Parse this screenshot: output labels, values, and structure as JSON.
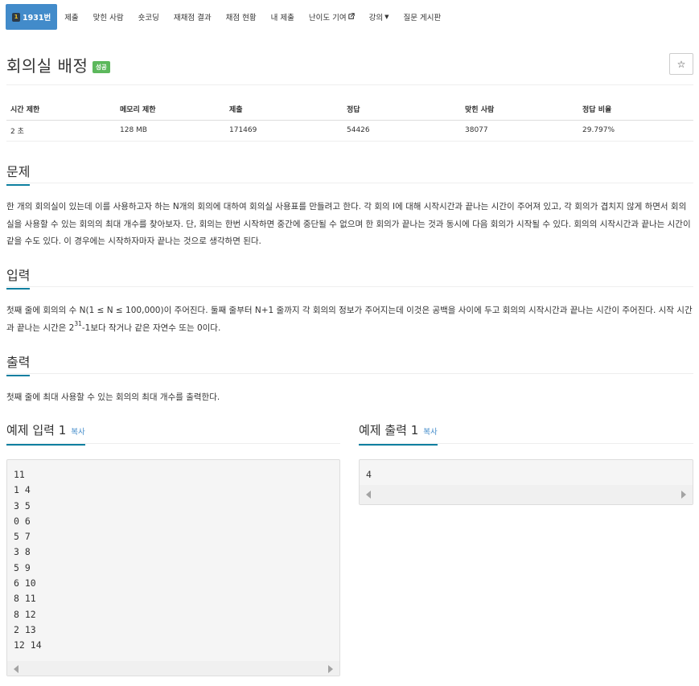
{
  "nav": {
    "problem_id": "1931번",
    "tabs": [
      "제출",
      "맞힌 사람",
      "숏코딩",
      "재채점 결과",
      "채점 현황",
      "내 제출",
      "난이도 기여",
      "강의",
      "질문 게시판"
    ],
    "tier_icon_glyph": "1"
  },
  "problem": {
    "title": "회의실 배정",
    "status_badge": "성공",
    "star_glyph": "☆"
  },
  "info_table": {
    "headers": [
      "시간 제한",
      "메모리 제한",
      "제출",
      "정답",
      "맞힌 사람",
      "정답 비율"
    ],
    "values": [
      "2 초",
      "128 MB",
      "171469",
      "54426",
      "38077",
      "29.797%"
    ]
  },
  "sections": {
    "description_title": "문제",
    "description_text": "한 개의 회의실이 있는데 이를 사용하고자 하는 N개의 회의에 대하여 회의실 사용표를 만들려고 한다. 각 회의 I에 대해 시작시간과 끝나는 시간이 주어져 있고, 각 회의가 겹치지 않게 하면서 회의실을 사용할 수 있는 회의의 최대 개수를 찾아보자. 단, 회의는 한번 시작하면 중간에 중단될 수 없으며 한 회의가 끝나는 것과 동시에 다음 회의가 시작될 수 있다. 회의의 시작시간과 끝나는 시간이 같을 수도 있다. 이 경우에는 시작하자마자 끝나는 것으로 생각하면 된다.",
    "input_title": "입력",
    "input_text_a": "첫째 줄에 회의의 수 N(1 ≤ N ≤ 100,000)이 주어진다. 둘째 줄부터 N+1 줄까지 각 회의의 정보가 주어지는데 이것은 공백을 사이에 두고 회의의 시작시간과 끝나는 시간이 주어진다. 시작 시간과 끝나는 시간은 2",
    "input_text_sup": "31",
    "input_text_b": "-1보다 작거나 같은 자연수 또는 0이다.",
    "output_title": "출력",
    "output_text": "첫째 줄에 최대 사용할 수 있는 회의의 최대 개수를 출력한다."
  },
  "samples": {
    "input_title": "예제 입력 1",
    "output_title": "예제 출력 1",
    "copy_label": "복사",
    "input_lines": [
      "11",
      "1 4",
      "3 5",
      "0 6",
      "5 7",
      "3 8",
      "5 9",
      "6 10",
      "8 11",
      "8 12",
      "2 13",
      "12 14"
    ],
    "output_lines": [
      "4"
    ]
  },
  "colors": {
    "active_tab": "#428bca",
    "success_badge": "#5cb85c",
    "section_underline": "#0e7fa0",
    "link": "#428bca"
  }
}
